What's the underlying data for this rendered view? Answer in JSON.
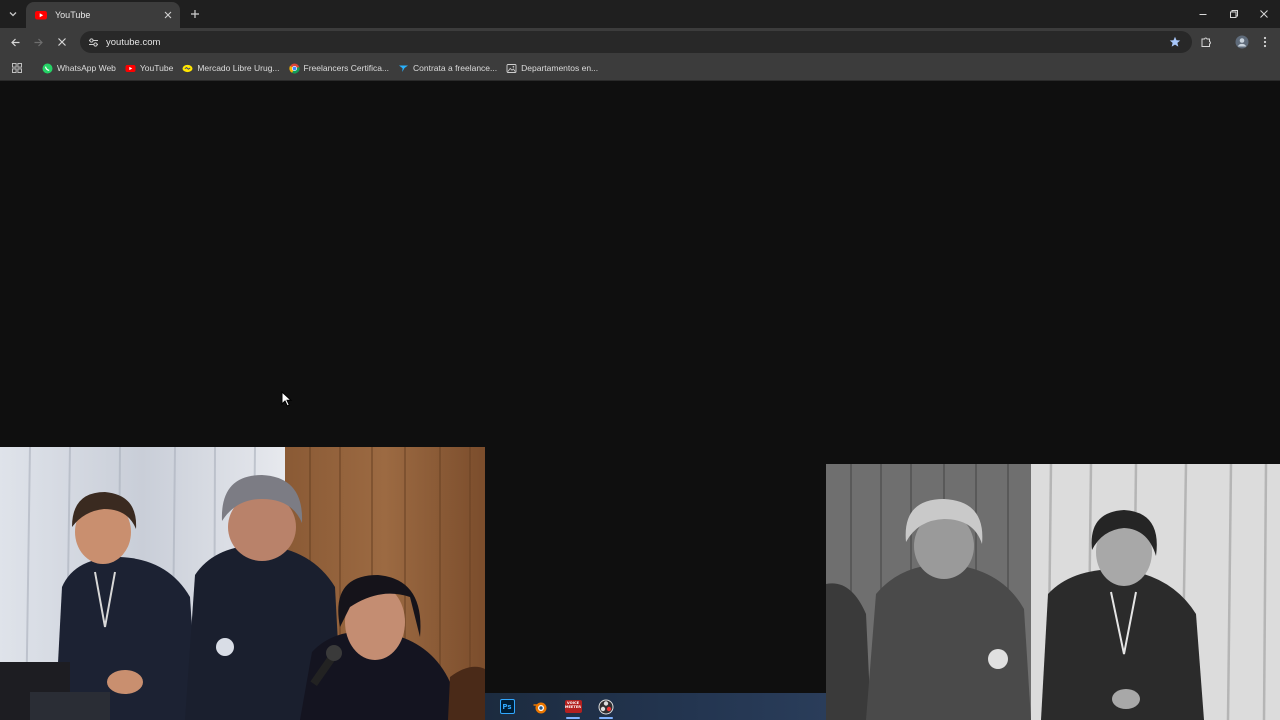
{
  "browser": {
    "tab": {
      "title": "YouTube",
      "favicon_icon": "youtube-icon"
    },
    "omnibox": {
      "url": "youtube.com"
    },
    "window_controls": [
      "minimize-icon",
      "restore-icon",
      "close-icon"
    ]
  },
  "bookmarks": [
    {
      "label": "WhatsApp Web",
      "icon": "whatsapp-icon",
      "color": "#25d366"
    },
    {
      "label": "YouTube",
      "icon": "youtube-icon",
      "color": "#ff0000"
    },
    {
      "label": "Mercado Libre Urug...",
      "icon": "mercadolibre-icon",
      "color": "#ffe600"
    },
    {
      "label": "Freelancers Certifica...",
      "icon": "chrome-icon",
      "color": "#4285f4"
    },
    {
      "label": "Contrata a freelance...",
      "icon": "freelancer-icon",
      "color": "#29b2fe"
    },
    {
      "label": "Departamentos en...",
      "icon": "image-icon",
      "color": "#cfcfcf"
    }
  ],
  "taskbar": {
    "apps": [
      {
        "name": "photoshop",
        "label": "Ps"
      },
      {
        "name": "blender",
        "label": ""
      },
      {
        "name": "voicemeeter",
        "label": "VOICE\nMEETER"
      },
      {
        "name": "obs",
        "label": ""
      }
    ]
  },
  "colors": {
    "page_background": "#0f0f0f",
    "titlebar": "#1f1f1f",
    "toolbar": "#3c3c3c",
    "star_accent": "#a8c7fa"
  }
}
